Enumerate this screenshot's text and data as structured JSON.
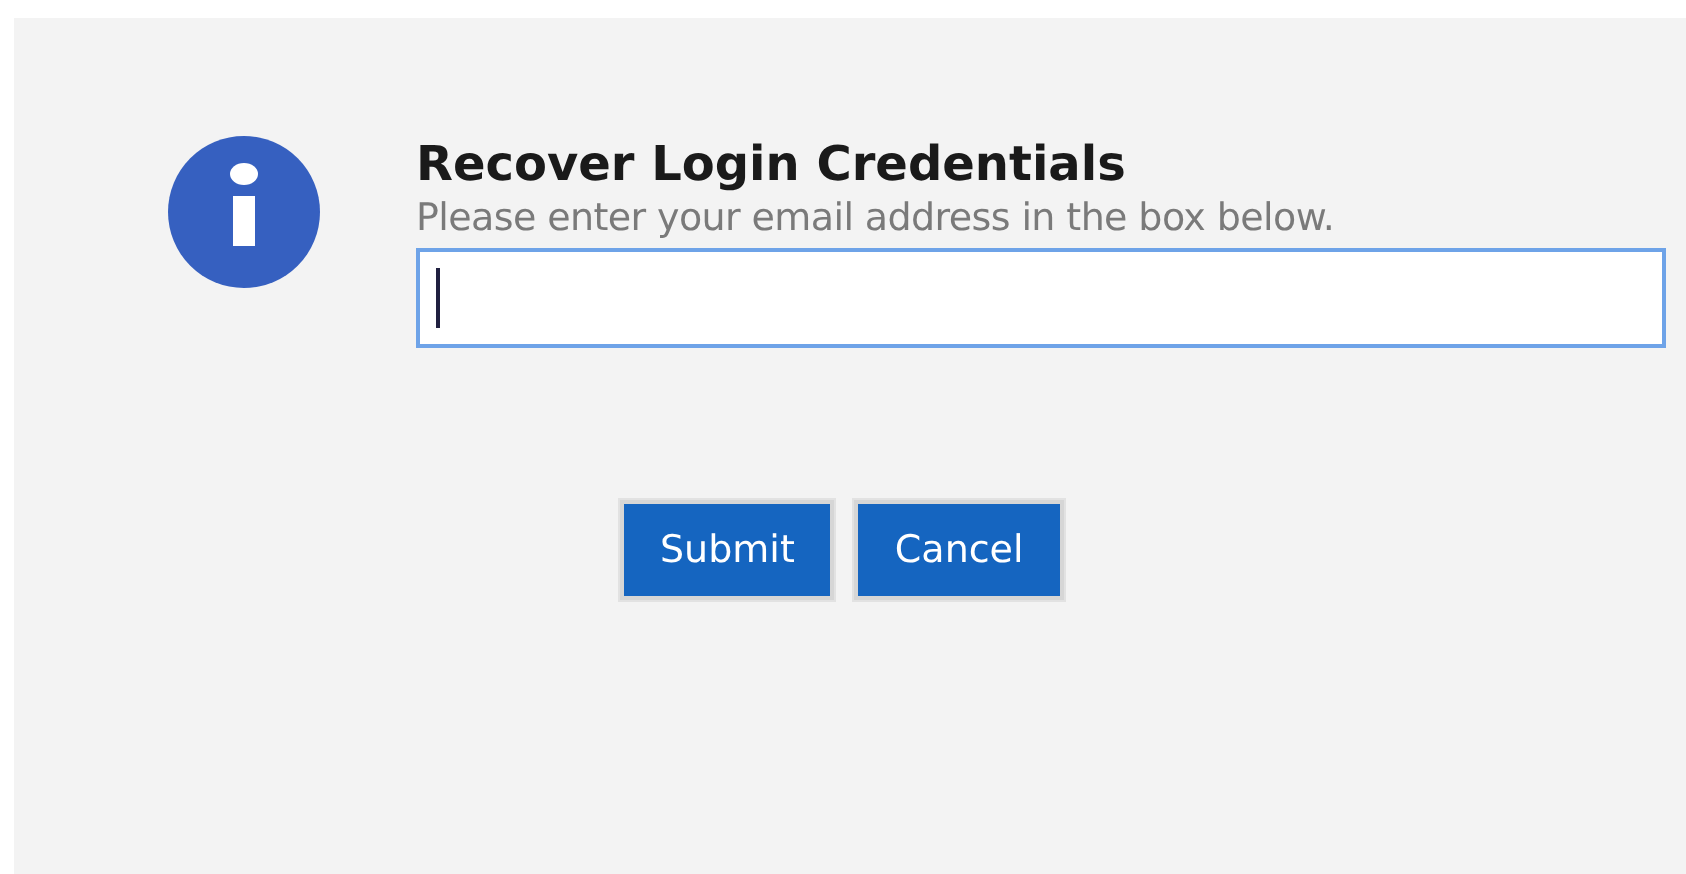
{
  "dialog": {
    "title": "Recover Login Credentials",
    "instruction": "Please enter your email address in the box below.",
    "email_field": {
      "focused": true
    },
    "buttons": [
      {
        "label": "Submit"
      },
      {
        "label": "Cancel"
      }
    ]
  }
}
